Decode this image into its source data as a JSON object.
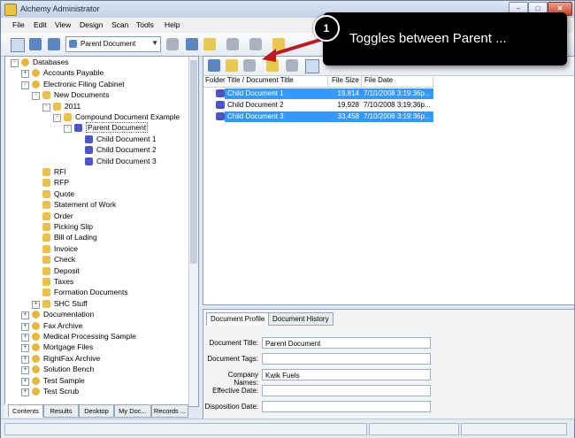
{
  "window": {
    "title": "Alchemy Administrator",
    "btn_min": "–",
    "btn_max": "□",
    "btn_close": "✕"
  },
  "menu": [
    "File",
    "Edit",
    "View",
    "Design",
    "Scan",
    "Tools",
    "Help"
  ],
  "toolbar": {
    "combo_value": "Parent Document",
    "combo_arrow": "▼"
  },
  "tree": [
    {
      "label": "Databases",
      "level": 0,
      "icon": "database-icon",
      "exp": "-"
    },
    {
      "label": "Accounts Payable",
      "level": 1,
      "icon": "database-icon",
      "exp": "+"
    },
    {
      "label": "Electronic Filing Cabinet",
      "level": 1,
      "icon": "database-icon",
      "exp": "-"
    },
    {
      "label": "New Documents",
      "level": 2,
      "icon": "folder-icon",
      "exp": "-"
    },
    {
      "label": "2011",
      "level": 3,
      "icon": "folder-icon",
      "exp": "-"
    },
    {
      "label": "Compound Document Example",
      "level": 4,
      "icon": "folder-icon",
      "exp": "-"
    },
    {
      "label": "Parent Document",
      "level": 5,
      "icon": "document-icon",
      "exp": "-"
    },
    {
      "label": "Child Document 1",
      "level": 6,
      "icon": "document-icon",
      "exp": ""
    },
    {
      "label": "Child Document 2",
      "level": 6,
      "icon": "document-icon",
      "exp": ""
    },
    {
      "label": "Child Document 3",
      "level": 6,
      "icon": "document-icon",
      "exp": ""
    },
    {
      "label": "RFI",
      "level": 2,
      "icon": "folder-icon",
      "exp": ""
    },
    {
      "label": "RFP",
      "level": 2,
      "icon": "folder-icon",
      "exp": ""
    },
    {
      "label": "Quote",
      "level": 2,
      "icon": "folder-icon",
      "exp": ""
    },
    {
      "label": "Statement of Work",
      "level": 2,
      "icon": "folder-icon",
      "exp": ""
    },
    {
      "label": "Order",
      "level": 2,
      "icon": "folder-icon",
      "exp": ""
    },
    {
      "label": "Picking Slip",
      "level": 2,
      "icon": "folder-icon",
      "exp": ""
    },
    {
      "label": "Bill of Lading",
      "level": 2,
      "icon": "folder-icon",
      "exp": ""
    },
    {
      "label": "Invoice",
      "level": 2,
      "icon": "folder-icon",
      "exp": ""
    },
    {
      "label": "Check",
      "level": 2,
      "icon": "folder-icon",
      "exp": ""
    },
    {
      "label": "Deposit",
      "level": 2,
      "icon": "folder-icon",
      "exp": ""
    },
    {
      "label": "Taxes",
      "level": 2,
      "icon": "folder-icon",
      "exp": ""
    },
    {
      "label": "Formation Documents",
      "level": 2,
      "icon": "folder-icon",
      "exp": ""
    },
    {
      "label": "SHC Stuff",
      "level": 2,
      "icon": "folder-icon",
      "exp": "+"
    },
    {
      "label": "Documentation",
      "level": 1,
      "icon": "database-icon",
      "exp": "+"
    },
    {
      "label": "Fax Archive",
      "level": 1,
      "icon": "database-icon",
      "exp": "+"
    },
    {
      "label": "Medical Processing Sample",
      "level": 1,
      "icon": "database-icon",
      "exp": "+"
    },
    {
      "label": "Mortgage Files",
      "level": 1,
      "icon": "database-icon",
      "exp": "+"
    },
    {
      "label": "RightFax Archive",
      "level": 1,
      "icon": "database-icon",
      "exp": "+"
    },
    {
      "label": "Solution Bench",
      "level": 1,
      "icon": "database-icon",
      "exp": "+"
    },
    {
      "label": "Test Sample",
      "level": 1,
      "icon": "database-icon",
      "exp": "+"
    },
    {
      "label": "Test Scrub",
      "level": 1,
      "icon": "database-icon",
      "exp": "+"
    }
  ],
  "bottom_tabs": [
    "Contents",
    "Results",
    "Desktop",
    "My Doc...",
    "Records ..."
  ],
  "list": {
    "headers": [
      "Folder Title / Document Title",
      "File Size",
      "File Date"
    ],
    "rows": [
      {
        "title": "Child Document 1",
        "size": "19,814",
        "date": "7/10/2008 3:19:36p...",
        "selected": true
      },
      {
        "title": "Child Document 2",
        "size": "19,928",
        "date": "7/10/2008 3:19:36p...",
        "selected": false
      },
      {
        "title": "Child Document 3",
        "size": "33,458",
        "date": "7/10/2008 3:19:36p...",
        "selected": true
      }
    ]
  },
  "profile": {
    "tabs": [
      "Document Profile",
      "Document History"
    ],
    "fields": [
      {
        "label": "Document Title:",
        "value": "Parent Document"
      },
      {
        "label": "Document Tags:",
        "value": ""
      },
      {
        "label": "Company Names:",
        "value": "Kwik Fuels"
      },
      {
        "label": "Effective Date:",
        "value": ""
      },
      {
        "label": "Disposition Date:",
        "value": ""
      }
    ]
  },
  "callout": {
    "number": "1",
    "text": "Toggles between Parent ..."
  },
  "colors": {
    "selection": "#3399ff",
    "callout_bg": "#000000",
    "arrow": "#c0171c"
  }
}
